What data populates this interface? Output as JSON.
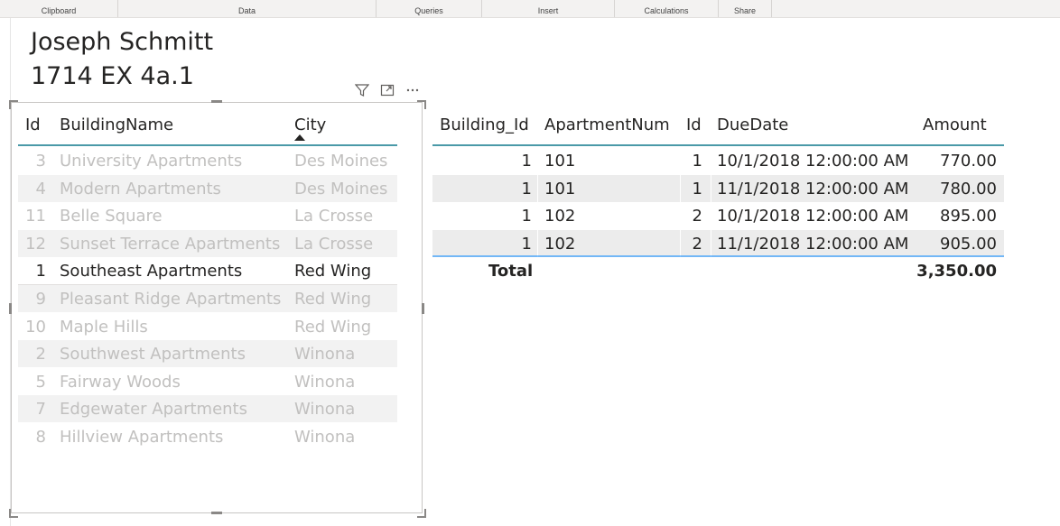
{
  "ribbon": {
    "groups": [
      "Clipboard",
      "Data",
      "Queries",
      "Insert",
      "Calculations",
      "Share"
    ]
  },
  "report": {
    "title_line1": "Joseph Schmitt",
    "title_line2": "1714 EX 4a.1"
  },
  "visual_icons": [
    "filter-icon",
    "focus-mode-icon",
    "more-options-icon"
  ],
  "buildings_table": {
    "headers": [
      "Id",
      "BuildingName",
      "City"
    ],
    "sorted_column": "City",
    "rows": [
      {
        "id": "3",
        "name": "University Apartments",
        "city": "Des Moines",
        "selected": false
      },
      {
        "id": "4",
        "name": "Modern Apartments",
        "city": "Des Moines",
        "selected": false
      },
      {
        "id": "11",
        "name": "Belle Square",
        "city": "La Crosse",
        "selected": false
      },
      {
        "id": "12",
        "name": "Sunset Terrace Apartments",
        "city": "La Crosse",
        "selected": false
      },
      {
        "id": "1",
        "name": "Southeast Apartments",
        "city": "Red Wing",
        "selected": true
      },
      {
        "id": "9",
        "name": "Pleasant Ridge Apartments",
        "city": "Red Wing",
        "selected": false
      },
      {
        "id": "10",
        "name": "Maple Hills",
        "city": "Red Wing",
        "selected": false
      },
      {
        "id": "2",
        "name": "Southwest Apartments",
        "city": "Winona",
        "selected": false
      },
      {
        "id": "5",
        "name": "Fairway Woods",
        "city": "Winona",
        "selected": false
      },
      {
        "id": "7",
        "name": "Edgewater Apartments",
        "city": "Winona",
        "selected": false
      },
      {
        "id": "8",
        "name": "Hillview Apartments",
        "city": "Winona",
        "selected": false
      }
    ]
  },
  "dues_table": {
    "headers": [
      "Building_Id",
      "ApartmentNum",
      "Id",
      "DueDate",
      "Amount"
    ],
    "rows": [
      {
        "building_id": "1",
        "apartment": "101",
        "id": "1",
        "due": "10/1/2018 12:00:00 AM",
        "amount": "770.00"
      },
      {
        "building_id": "1",
        "apartment": "101",
        "id": "1",
        "due": "11/1/2018 12:00:00 AM",
        "amount": "780.00"
      },
      {
        "building_id": "1",
        "apartment": "102",
        "id": "2",
        "due": "10/1/2018 12:00:00 AM",
        "amount": "895.00"
      },
      {
        "building_id": "1",
        "apartment": "102",
        "id": "2",
        "due": "11/1/2018 12:00:00 AM",
        "amount": "905.00"
      }
    ],
    "total_label": "Total",
    "total_amount": "3,350.00"
  },
  "colors": {
    "accent_line": "#118dff",
    "header_underline": "#4a9aa8",
    "dimmed_text": "#c1c0bf",
    "normal_text": "#252423"
  }
}
